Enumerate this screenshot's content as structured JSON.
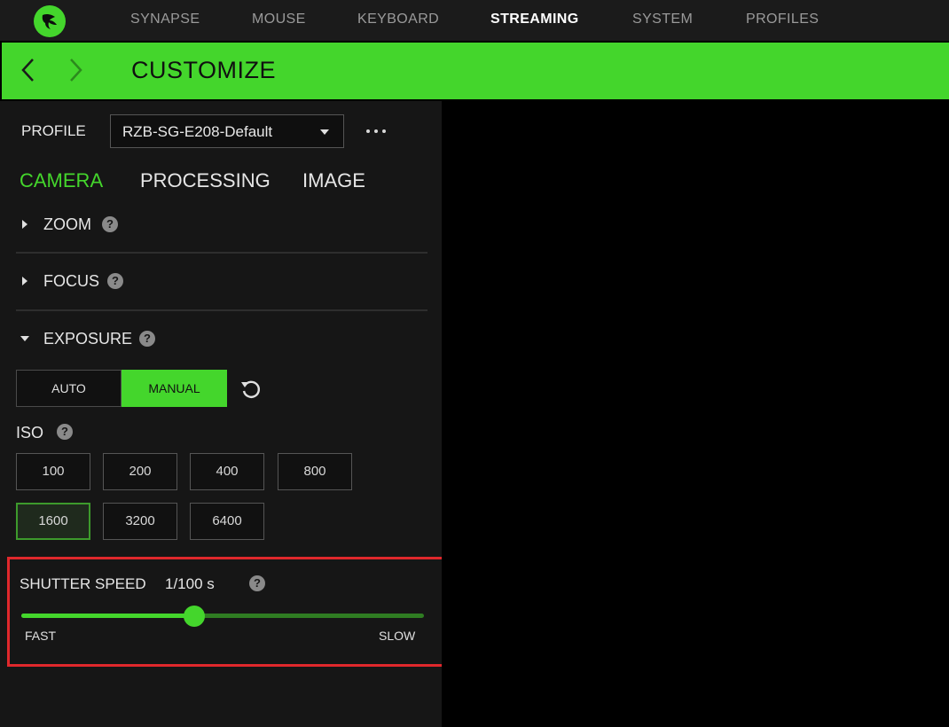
{
  "nav": {
    "items": [
      "SYNAPSE",
      "MOUSE",
      "KEYBOARD",
      "STREAMING",
      "SYSTEM",
      "PROFILES"
    ],
    "active": "STREAMING"
  },
  "header": {
    "title": "CUSTOMIZE",
    "back_icon": "chevron-left-icon",
    "forward_icon": "chevron-right-icon"
  },
  "profile": {
    "label": "PROFILE",
    "selected": "RZB-SG-E208-Default"
  },
  "tabs": [
    "CAMERA",
    "PROCESSING",
    "IMAGE"
  ],
  "active_tab": "CAMERA",
  "sections": {
    "zoom": "ZOOM",
    "focus": "FOCUS",
    "exposure": "EXPOSURE"
  },
  "exposure": {
    "auto_label": "AUTO",
    "manual_label": "MANUAL",
    "mode": "MANUAL",
    "iso_label": "ISO",
    "iso_values": [
      "100",
      "200",
      "400",
      "800",
      "1600",
      "3200",
      "6400"
    ],
    "iso_selected": "1600"
  },
  "shutter": {
    "label": "SHUTTER SPEED",
    "value": "1/100 s",
    "slider_fraction": 0.43,
    "min_label": "FAST",
    "max_label": "SLOW"
  },
  "colors": {
    "accent": "#44d62c",
    "highlight": "#e0282c"
  }
}
